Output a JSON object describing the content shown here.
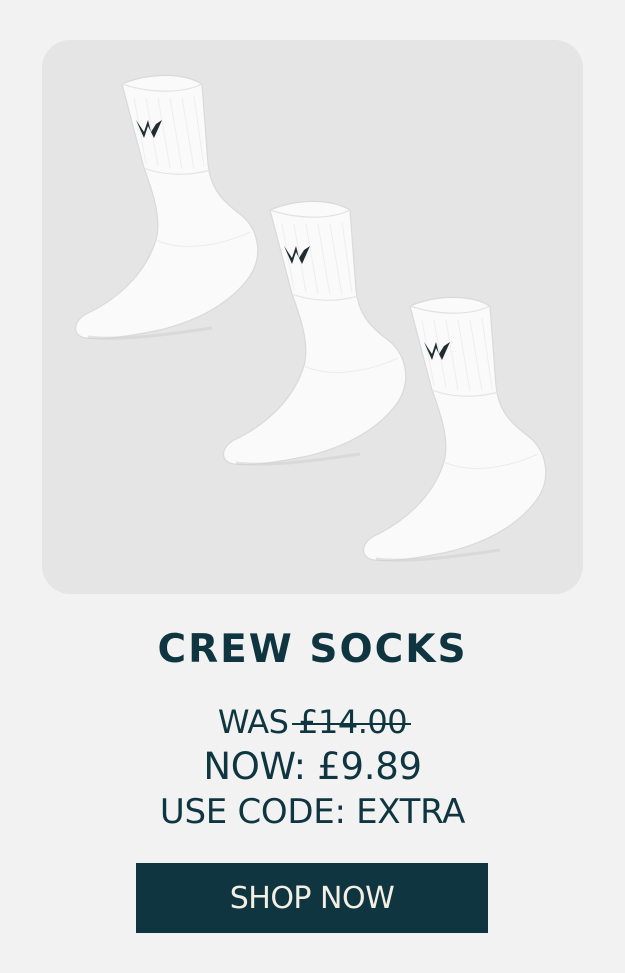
{
  "product": {
    "name": "CREW SOCKS",
    "image_alt": "three white crew socks",
    "price": {
      "was_label": "WAS",
      "was_value": "£14.00",
      "now_text": "NOW: £9.89"
    },
    "promo": {
      "text": "USE CODE: EXTRA"
    },
    "cta_label": "SHOP NOW"
  },
  "colors": {
    "page_background": "#f2f2f2",
    "image_background": "#e5e5e5",
    "brand_text": "#0f3640",
    "button_background": "#0f3640",
    "button_text": "#f4efe3",
    "sock": "#fafafa",
    "sock_shadow": "#d4d4d4",
    "logo": "#1d2d33"
  }
}
